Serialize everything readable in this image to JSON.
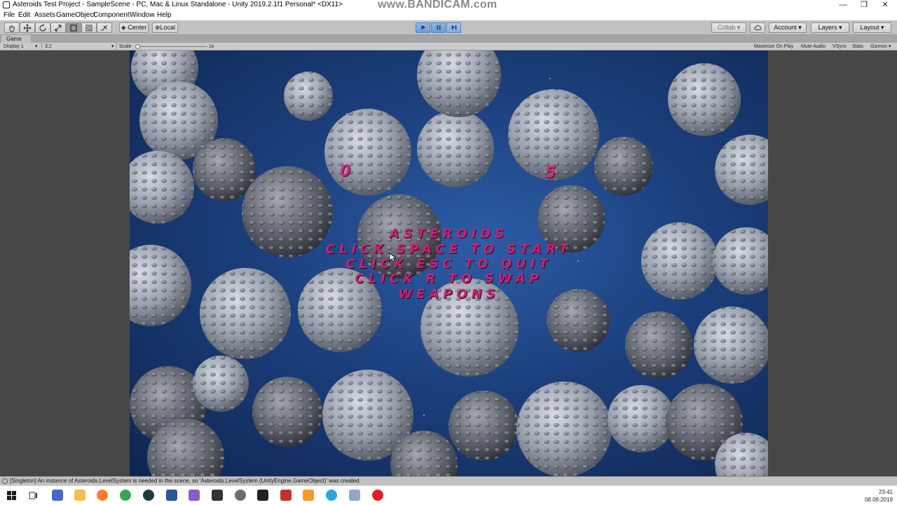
{
  "window": {
    "title": "Asteroids Test Project - SampleScene - PC, Mac & Linux Standalone - Unity 2019.2.1f1 Personal* <DX11>",
    "watermark": "www.BANDICAM.com",
    "minimize": "—",
    "restore": "❐",
    "close": "✕"
  },
  "menu": [
    "File",
    "Edit",
    "Assets",
    "GameObject",
    "Component",
    "Window",
    "Help"
  ],
  "toolbar": {
    "pivot_label": "Center",
    "space_label": "Local",
    "collab_label": "Collab",
    "account_label": "Account",
    "layers_label": "Layers",
    "layout_label": "Layout",
    "dropdown_arrow": "▾"
  },
  "game_tab": {
    "tab_label": "Game",
    "display_label": "Display 1",
    "aspect_label": "3:2",
    "scale_label": "Scale",
    "scale_value": "1x",
    "maximize_label": "Maximize On Play",
    "mute_label": "Mute Audio",
    "vsync_label": "VSync",
    "stats_label": "Stats",
    "gizmos_label": "Gizmos"
  },
  "game": {
    "score_left": "0",
    "score_right": "5",
    "menu_lines": [
      "ASTEROIDS",
      "CLICK SPACE TO START",
      "CLICK ESC TO QUIT",
      "CLICK R TO SWAP",
      "WEAPONS"
    ]
  },
  "console": {
    "message": "[Singleton] An instance of Asteroids.LevelSystem is needed in the scene, so 'Asteroids.LevelSystem (UnityEngine.GameObject)' was created."
  },
  "taskbar": {
    "time": "23:41",
    "date": "08.09.2019"
  },
  "colors": {
    "accent": "#c92274",
    "play_active": "#6c9bd3",
    "space_bg": "#1b3f7c",
    "editor_bg": "#c2c2c2"
  }
}
